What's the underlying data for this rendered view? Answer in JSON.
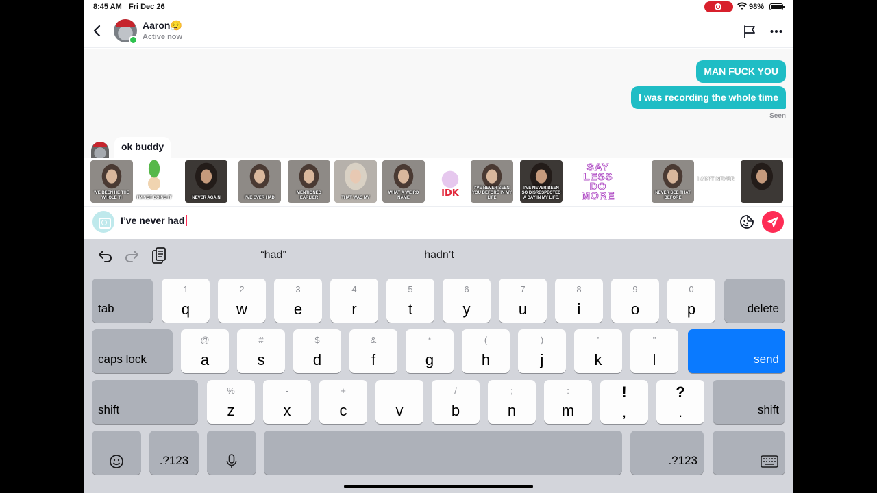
{
  "status_bar": {
    "time": "8:45 AM",
    "date": "Fri Dec 26",
    "battery": "98%",
    "battery_level": 0.98
  },
  "header": {
    "contact_name": "Aaron😮‍💨",
    "contact_status": "Active now"
  },
  "messages": {
    "outgoing": [
      "MAN FUCK YOU",
      "I was recording the whole time"
    ],
    "seen_label": "Seen",
    "incoming": [
      "ok buddy"
    ]
  },
  "stickers": [
    {
      "type": "photo",
      "caption": "'VE BEEN HE THE WHOLE TI"
    },
    {
      "type": "green",
      "caption": "I'M NOT DOING IT"
    },
    {
      "type": "dark",
      "caption": "NEVER AGAIN"
    },
    {
      "type": "photo",
      "caption": "I'VE EVER HAD"
    },
    {
      "type": "photo",
      "caption": "MENTIONED EARLIER"
    },
    {
      "type": "light",
      "caption": "THAT WAS MY"
    },
    {
      "type": "photo",
      "caption": "WHAT A WEIRD NAME"
    },
    {
      "type": "bunny",
      "caption": "IDK"
    },
    {
      "type": "photo",
      "caption": "I'VE NEVER SEEN YOU BEFORE IN MY LIFE"
    },
    {
      "type": "dark",
      "caption": "I've never been so disrespected a day in my life."
    },
    {
      "type": "text",
      "caption": "SAY LESS DO MORE"
    },
    {
      "type": "photo",
      "caption": "NEVER SEE THAT BEFORE"
    },
    {
      "type": "plain",
      "caption": "I AIN'T NEVER"
    },
    {
      "type": "dark",
      "caption": ""
    },
    {
      "type": "plain",
      "caption": ""
    }
  ],
  "input": {
    "value": "I’ve never had"
  },
  "keyboard": {
    "suggestions": [
      "“had”",
      "hadn’t",
      ""
    ],
    "row1": [
      {
        "hint": "1",
        "key": "q"
      },
      {
        "hint": "2",
        "key": "w"
      },
      {
        "hint": "3",
        "key": "e"
      },
      {
        "hint": "4",
        "key": "r"
      },
      {
        "hint": "5",
        "key": "t"
      },
      {
        "hint": "6",
        "key": "y"
      },
      {
        "hint": "7",
        "key": "u"
      },
      {
        "hint": "8",
        "key": "i"
      },
      {
        "hint": "9",
        "key": "o"
      },
      {
        "hint": "0",
        "key": "p"
      }
    ],
    "row2": [
      {
        "hint": "@",
        "key": "a"
      },
      {
        "hint": "#",
        "key": "s"
      },
      {
        "hint": "$",
        "key": "d"
      },
      {
        "hint": "&",
        "key": "f"
      },
      {
        "hint": "*",
        "key": "g"
      },
      {
        "hint": "(",
        "key": "h"
      },
      {
        "hint": ")",
        "key": "j"
      },
      {
        "hint": "’",
        "key": "k"
      },
      {
        "hint": "\"",
        "key": "l"
      }
    ],
    "row3": [
      {
        "hint": "%",
        "key": "z"
      },
      {
        "hint": "-",
        "key": "x"
      },
      {
        "hint": "+",
        "key": "c"
      },
      {
        "hint": "=",
        "key": "v"
      },
      {
        "hint": "/",
        "key": "b"
      },
      {
        "hint": ";",
        "key": "n"
      },
      {
        "hint": ":",
        "key": "m"
      }
    ],
    "punct1": {
      "top": "!",
      "bottom": ","
    },
    "punct2": {
      "top": "?",
      "bottom": "."
    },
    "tab": "tab",
    "delete": "delete",
    "caps_lock": "caps lock",
    "send": "send",
    "shift": "shift",
    "numbers_left": ".?123",
    "numbers_right": ".?123"
  },
  "colors": {
    "bubble_out": "#1fbdc5",
    "send_button": "#fe2c55",
    "key_send": "#0a7aff"
  }
}
